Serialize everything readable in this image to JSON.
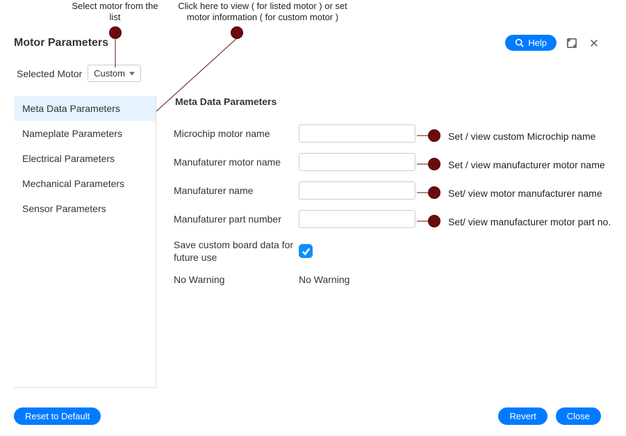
{
  "annotations": {
    "top1": "Select motor from the list",
    "top2": "Click here to view ( for listed motor ) or set motor information ( for custom motor )",
    "right1": "Set / view custom Microchip name",
    "right2": "Set / view manufacturer motor name",
    "right3": "Set/ view motor manufacturer name",
    "right4": "Set/ view manufacturer motor part no."
  },
  "header": {
    "title": "Motor Parameters",
    "help": "Help"
  },
  "selected_motor": {
    "label": "Selected Motor",
    "value": "Custom"
  },
  "sidebar": {
    "items": [
      {
        "label": "Meta Data Parameters"
      },
      {
        "label": "Nameplate Parameters"
      },
      {
        "label": "Electrical Parameters"
      },
      {
        "label": "Mechanical Parameters"
      },
      {
        "label": "Sensor Parameters"
      }
    ]
  },
  "content": {
    "heading": "Meta Data Parameters",
    "fields": {
      "microchip_name": {
        "label": "Microchip motor name",
        "value": ""
      },
      "mfr_motor_name": {
        "label": "Manufaturer motor name",
        "value": ""
      },
      "mfr_name": {
        "label": "Manufaturer name",
        "value": ""
      },
      "mfr_part": {
        "label": "Manufaturer part number",
        "value": ""
      },
      "save_custom": {
        "label": "Save custom board data for future use",
        "checked": true
      },
      "nowarn_left": "No Warning",
      "nowarn_right": "No Warning"
    }
  },
  "footer": {
    "reset": "Reset to Default",
    "revert": "Revert",
    "close": "Close"
  }
}
